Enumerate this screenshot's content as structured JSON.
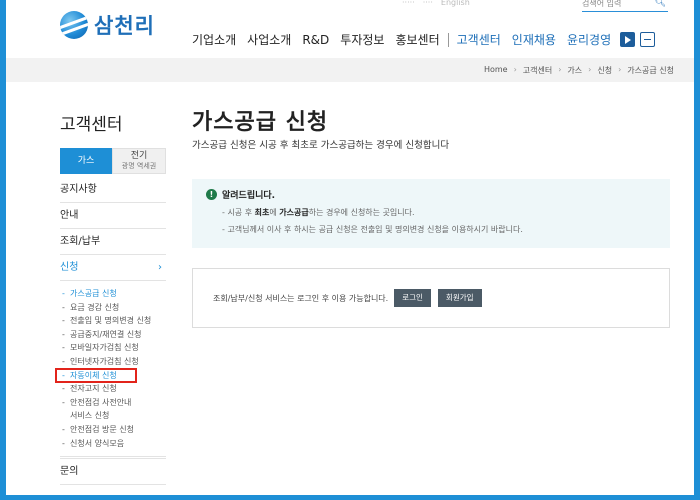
{
  "brand": {
    "name": "삼천리"
  },
  "top_util": {
    "items": [
      "·····",
      "····",
      "English"
    ],
    "search_placeholder": "검색어 입력"
  },
  "gnb": {
    "items": [
      "기업소개",
      "사업소개",
      "R&D",
      "투자정보",
      "홍보센터"
    ],
    "items_blue": [
      "고객센터",
      "인재채용",
      "윤리경영"
    ]
  },
  "breadcrumb": [
    "Home",
    "고객센터",
    "가스",
    "신청",
    "가스공급 신청"
  ],
  "sidebar": {
    "title": "고객센터",
    "tabs": [
      {
        "label": "가스",
        "sub": ""
      },
      {
        "label": "전기",
        "sub": "광명 역세권"
      }
    ],
    "menu": [
      "공지사항",
      "안내",
      "조회/납부",
      "신청"
    ],
    "sub_items": [
      "가스공급 신청",
      "요금 경감 신청",
      "전출입 및 명의변경 신청",
      "공급중지/재연결 신청",
      "모바일자가검침 신청",
      "인터넷자가검침 신청",
      "자동이체 신청",
      "전자고지 신청",
      "안전점검 사전안내",
      "서비스 신청",
      "안전점검 방문 신청",
      "신청서 양식모음"
    ],
    "bottom_menu": "문의"
  },
  "main": {
    "title": "가스공급 신청",
    "desc": "가스공급 신청은 시공 후 최초로 가스공급하는 경우에 신청합니다",
    "notice": {
      "heading": "알려드립니다.",
      "line1_pre": "시공 후 ",
      "line1_b1": "최초",
      "line1_mid": "에 ",
      "line1_b2": "가스공급",
      "line1_post": "하는 경우에 신청하는 곳입니다.",
      "line2": "고객님께서 이사 후 하시는 공급 신청은 전출입 및 명의변경 신청을 이용하시기 바랍니다."
    },
    "login": {
      "message": "조회/납부/신청 서비스는 로그인 후 이용 가능합니다.",
      "login_label": "로그인",
      "join_label": "회원가입"
    }
  }
}
